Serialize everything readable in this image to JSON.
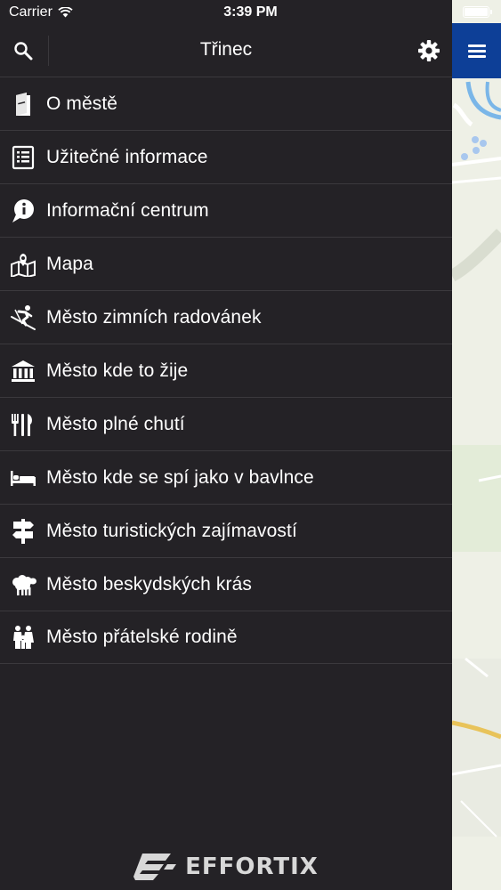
{
  "status_bar": {
    "carrier": "Carrier",
    "time": "3:39 PM"
  },
  "header": {
    "title": "Třinec",
    "search_icon": "search-icon",
    "settings_icon": "gear-icon"
  },
  "menu": {
    "items": [
      {
        "label": "O městě",
        "icon": "book-icon"
      },
      {
        "label": "Užitečné informace",
        "icon": "document-list-icon"
      },
      {
        "label": "Informační centrum",
        "icon": "info-bubble-icon"
      },
      {
        "label": "Mapa",
        "icon": "map-pin-icon"
      },
      {
        "label": "Město zimních radovánek",
        "icon": "skier-icon"
      },
      {
        "label": "Město kde to žije",
        "icon": "museum-icon"
      },
      {
        "label": "Město plné chutí",
        "icon": "cutlery-icon"
      },
      {
        "label": "Město kde se spí jako v bavlnce",
        "icon": "bed-icon"
      },
      {
        "label": "Město turistických zajímavostí",
        "icon": "signpost-icon"
      },
      {
        "label": "Město beskydských krás",
        "icon": "sheep-icon"
      },
      {
        "label": "Město přátelské rodině",
        "icon": "family-icon"
      }
    ]
  },
  "footer": {
    "brand": "EFFORTIX"
  },
  "colors": {
    "background": "#242226",
    "divider": "#3b393d",
    "menu_button": "#0d3f97",
    "map": "#eef0e6"
  }
}
